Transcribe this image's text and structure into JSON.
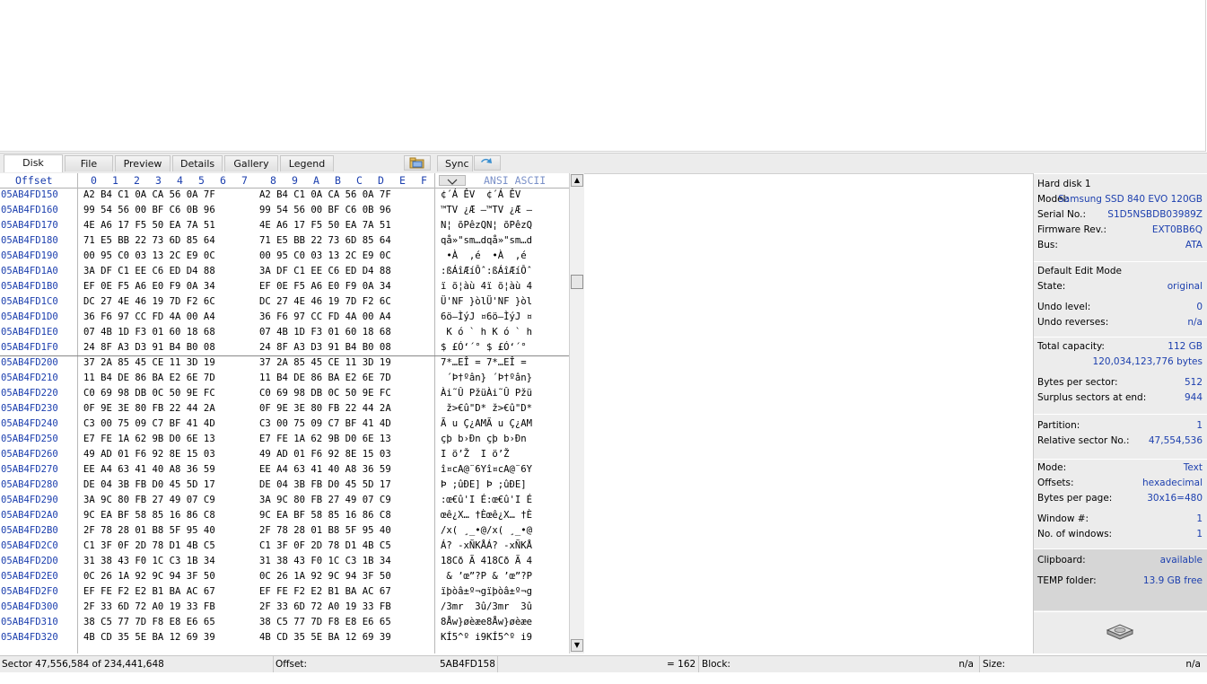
{
  "tabs": [
    "Disk",
    "File",
    "Preview",
    "Details",
    "Gallery",
    "Legend"
  ],
  "sync_label": "Sync",
  "hex_header": {
    "offset_label": "Offset",
    "columns": [
      "0",
      "1",
      "2",
      "3",
      "4",
      "5",
      "6",
      "7",
      "8",
      "9",
      "A",
      "B",
      "C",
      "D",
      "E",
      "F"
    ],
    "ascii_label": "ANSI ASCII"
  },
  "rows": [
    {
      "offset": "05AB4FD150",
      "hex1": "A2 B4 C1 0A CA 56 0A 7F",
      "hex2": "A2 B4 C1 0A CA 56 0A 7F",
      "ascii": "¢´Á ÊV  ¢´Á ÊV "
    },
    {
      "offset": "05AB4FD160",
      "hex1": "99 54 56 00 BF C6 0B 96",
      "hex2": "99 54 56 00 BF C6 0B 96",
      "ascii": "™TV ¿Æ –™TV ¿Æ –"
    },
    {
      "offset": "05AB4FD170",
      "hex1": "4E A6 17 F5 50 EA 7A 51",
      "hex2": "4E A6 17 F5 50 EA 7A 51",
      "ascii": "N¦ õPêzQN¦ õPêzQ"
    },
    {
      "offset": "05AB4FD180",
      "hex1": "71 E5 BB 22 73 6D 85 64",
      "hex2": "71 E5 BB 22 73 6D 85 64",
      "ascii": "qå»\"sm…dqå»\"sm…d"
    },
    {
      "offset": "05AB4FD190",
      "hex1": "00 95 C0 03 13 2C E9 0C",
      "hex2": "00 95 C0 03 13 2C E9 0C",
      "ascii": " •À  ,é  •À  ,é "
    },
    {
      "offset": "05AB4FD1A0",
      "hex1": "3A DF C1 EE C6 ED D4 88",
      "hex2": "3A DF C1 EE C6 ED D4 88",
      "ascii": ":ßÁîÆíÔˆ:ßÁîÆíÔˆ"
    },
    {
      "offset": "05AB4FD1B0",
      "hex1": "EF 0E F5 A6 E0 F9 0A 34",
      "hex2": "EF 0E F5 A6 E0 F9 0A 34",
      "ascii": "ï õ¦àù 4ï õ¦àù 4"
    },
    {
      "offset": "05AB4FD1C0",
      "hex1": "DC 27 4E 46 19 7D F2 6C",
      "hex2": "DC 27 4E 46 19 7D F2 6C",
      "ascii": "Ü'NF }òlÜ'NF }òl"
    },
    {
      "offset": "05AB4FD1D0",
      "hex1": "36 F6 97 CC FD 4A 00 A4",
      "hex2": "36 F6 97 CC FD 4A 00 A4",
      "ascii": "6ö—ÌýJ ¤6ö—ÌýJ ¤"
    },
    {
      "offset": "05AB4FD1E0",
      "hex1": "07 4B 1D F3 01 60 18 68",
      "hex2": "07 4B 1D F3 01 60 18 68",
      "ascii": " K ó ` h K ó ` h"
    },
    {
      "offset": "05AB4FD1F0",
      "hex1": "24 8F A3 D3 91 B4 B0 08",
      "hex2": "24 8F A3 D3 91 B4 B0 08",
      "ascii": "$ £Ó‘´° $ £Ó‘´° "
    },
    {
      "offset": "05AB4FD200",
      "hex1": "37 2A 85 45 CE 11 3D 19",
      "hex2": "37 2A 85 45 CE 11 3D 19",
      "ascii": "7*…EÎ = 7*…EÎ = "
    },
    {
      "offset": "05AB4FD210",
      "hex1": "11 B4 DE 86 BA E2 6E 7D",
      "hex2": "11 B4 DE 86 BA E2 6E 7D",
      "ascii": " ´Þ†ºân} ´Þ†ºân}"
    },
    {
      "offset": "05AB4FD220",
      "hex1": "C0 69 98 DB 0C 50 9E FC",
      "hex2": "C0 69 98 DB 0C 50 9E FC",
      "ascii": "Ài˜Û PžüÀi˜Û Pžü"
    },
    {
      "offset": "05AB4FD230",
      "hex1": "0F 9E 3E 80 FB 22 44 2A",
      "hex2": "0F 9E 3E 80 FB 22 44 2A",
      "ascii": " ž>€û\"D* ž>€û\"D*"
    },
    {
      "offset": "05AB4FD240",
      "hex1": "C3 00 75 09 C7 BF 41 4D",
      "hex2": "C3 00 75 09 C7 BF 41 4D",
      "ascii": "Ã u Ç¿AMÃ u Ç¿AM"
    },
    {
      "offset": "05AB4FD250",
      "hex1": "E7 FE 1A 62 9B D0 6E 13",
      "hex2": "E7 FE 1A 62 9B D0 6E 13",
      "ascii": "çþ b›Ðn çþ b›Ðn "
    },
    {
      "offset": "05AB4FD260",
      "hex1": "49 AD 01 F6 92 8E 15 03",
      "hex2": "49 AD 01 F6 92 8E 15 03",
      "ascii": "I­ ö’Ž  I­ ö’Ž  "
    },
    {
      "offset": "05AB4FD270",
      "hex1": "EE A4 63 41 40 A8 36 59",
      "hex2": "EE A4 63 41 40 A8 36 59",
      "ascii": "î¤cA@¨6Yî¤cA@¨6Y"
    },
    {
      "offset": "05AB4FD280",
      "hex1": "DE 04 3B FB D0 45 5D 17",
      "hex2": "DE 04 3B FB D0 45 5D 17",
      "ascii": "Þ ;ûÐE] Þ ;ûÐE] "
    },
    {
      "offset": "05AB4FD290",
      "hex1": "3A 9C 80 FB 27 49 07 C9",
      "hex2": "3A 9C 80 FB 27 49 07 C9",
      "ascii": ":œ€û'I É:œ€û'I É"
    },
    {
      "offset": "05AB4FD2A0",
      "hex1": "9C EA BF 58 85 16 86 C8",
      "hex2": "9C EA BF 58 85 16 86 C8",
      "ascii": "œê¿X… †Èœê¿X… †È"
    },
    {
      "offset": "05AB4FD2B0",
      "hex1": "2F 78 28 01 B8 5F 95 40",
      "hex2": "2F 78 28 01 B8 5F 95 40",
      "ascii": "/x( ¸_•@/x( ¸_•@"
    },
    {
      "offset": "05AB4FD2C0",
      "hex1": "C1 3F 0F 2D 78 D1 4B C5",
      "hex2": "C1 3F 0F 2D 78 D1 4B C5",
      "ascii": "Á? -xÑKÅÁ? -xÑKÅ"
    },
    {
      "offset": "05AB4FD2D0",
      "hex1": "31 38 43 F0 1C C3 1B 34",
      "hex2": "31 38 43 F0 1C C3 1B 34",
      "ascii": "18Cð Ã 418Cð Ã 4"
    },
    {
      "offset": "05AB4FD2E0",
      "hex1": "0C 26 1A 92 9C 94 3F 50",
      "hex2": "0C 26 1A 92 9C 94 3F 50",
      "ascii": " & ’œ”?P & ’œ”?P"
    },
    {
      "offset": "05AB4FD2F0",
      "hex1": "EF FE F2 E2 B1 BA AC 67",
      "hex2": "EF FE F2 E2 B1 BA AC 67",
      "ascii": "ïþòâ±º¬gïþòâ±º¬g"
    },
    {
      "offset": "05AB4FD300",
      "hex1": "2F 33 6D 72 A0 19 33 FB",
      "hex2": "2F 33 6D 72 A0 19 33 FB",
      "ascii": "/3mr  3û/3mr  3û"
    },
    {
      "offset": "05AB4FD310",
      "hex1": "38 C5 77 7D F8 E8 E6 65",
      "hex2": "38 C5 77 7D F8 E8 E6 65",
      "ascii": "8Åw}øèæe8Åw}øèæe"
    },
    {
      "offset": "05AB4FD320",
      "hex1": "4B CD 35 5E BA 12 69 39",
      "hex2": "4B CD 35 5E BA 12 69 39",
      "ascii": "KÍ5^º i9KÍ5^º i9"
    }
  ],
  "info": {
    "device_title": "Hard disk 1",
    "model_label": "Model:",
    "model": "Samsung SSD 840 EVO 120GB",
    "serial_label": "Serial No.:",
    "serial": "S1D5NSBDB03989Z",
    "firmware_label": "Firmware Rev.:",
    "firmware": "EXT0BB6Q",
    "bus_label": "Bus:",
    "bus": "ATA",
    "edit_mode": "Default Edit Mode",
    "state_label": "State:",
    "state": "original",
    "undo_level_label": "Undo level:",
    "undo_level": "0",
    "undo_reverses_label": "Undo reverses:",
    "undo_reverses": "n/a",
    "total_capacity_label": "Total capacity:",
    "total_capacity": "112 GB",
    "total_bytes": "120,034,123,776 bytes",
    "bytes_per_sector_label": "Bytes per sector:",
    "bytes_per_sector": "512",
    "surplus_label": "Surplus sectors at end:",
    "surplus": "944",
    "partition_label": "Partition:",
    "partition": "1",
    "rel_sector_label": "Relative sector No.:",
    "rel_sector": "47,554,536",
    "mode_label": "Mode:",
    "mode": "Text",
    "offsets_label": "Offsets:",
    "offsets": "hexadecimal",
    "bytes_per_page_label": "Bytes per page:",
    "bytes_per_page": "30x16=480",
    "window_label": "Window #:",
    "window": "1",
    "windows_label": "No. of windows:",
    "windows": "1",
    "clipboard_label": "Clipboard:",
    "clipboard": "available",
    "temp_label": "TEMP folder:",
    "temp": "13.9 GB free"
  },
  "status": {
    "sector": "Sector 47,556,584 of 234,441,648",
    "offset_label": "Offset:",
    "offset_value": "5AB4FD158",
    "eq_value": "= 162",
    "block_label": "Block:",
    "block_value": "n/a",
    "size_label": "Size:",
    "size_value": "n/a"
  },
  "colors": {
    "offset_blue": "#1c3fae",
    "panel_gray": "#ececec"
  },
  "icons": [
    "open-folder-icon",
    "sync-arrow-icon",
    "hard-disk-icon",
    "dropdown-arrow-icon"
  ]
}
